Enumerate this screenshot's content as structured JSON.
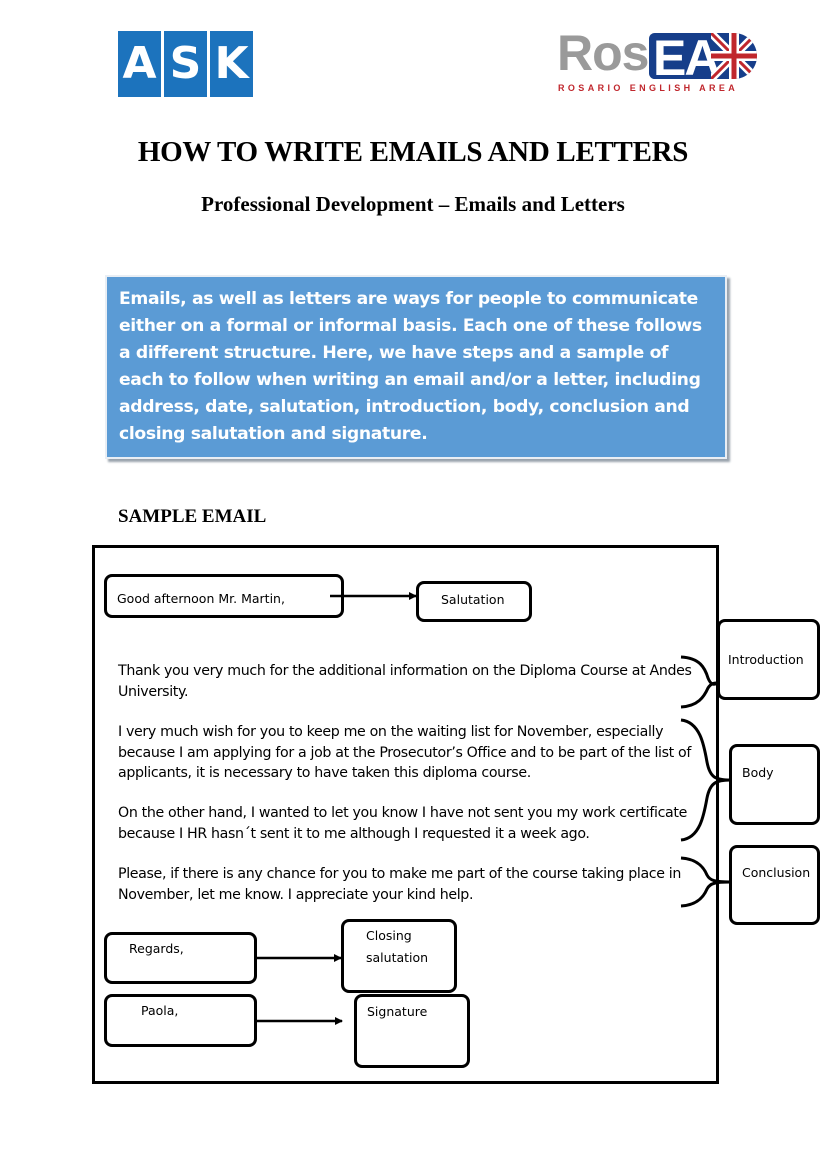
{
  "logos": {
    "ask": {
      "letters": [
        "A",
        "S",
        "K"
      ],
      "color": "#1c73bd"
    },
    "rosea": {
      "prefix": "Ros",
      "badge": "EA",
      "tagline": "ROSARIO ENGLISH AREA",
      "prefix_color": "#9a9a9a",
      "badge_color": "#163e8a",
      "tagline_color": "#c0272d"
    }
  },
  "header": {
    "title": "HOW TO WRITE EMAILS AND LETTERS",
    "subtitle": "Professional Development – Emails and Letters"
  },
  "intro": {
    "text": "Emails, as well as letters are ways for people to communicate either on a formal or informal basis. Each one of these follows a different structure. Here, we have steps and a sample of each to follow when writing an email and/or a letter, including address, date, salutation, introduction, body, conclusion and closing salutation and signature.",
    "background_color": "#5b9bd5"
  },
  "sample_email": {
    "heading": "SAMPLE EMAIL",
    "greeting": "Good afternoon Mr. Martin,",
    "paragraphs": [
      "Thank you very much for the additional information on the Diploma Course at Andes University.",
      "I very much wish for you to keep me on the waiting list for November, especially because I am applying for a job at the Prosecutor’s Office and to be part of the list of applicants, it is necessary to have taken this diploma course.",
      "On the other hand, I wanted to let you know I have not sent you my work certificate because I HR hasn´t sent it to me although I requested it a week ago.",
      "Please, if there is any chance for you to make me part of the course taking place in November, let me know. I appreciate your kind help."
    ],
    "closing": "Regards,",
    "signature": "Paola,"
  },
  "labels": {
    "salutation": "Salutation",
    "introduction": "Introduction",
    "body": "Body",
    "conclusion": "Conclusion",
    "closing_line1": "Closing",
    "closing_line2": "salutation",
    "signature": "Signature"
  }
}
